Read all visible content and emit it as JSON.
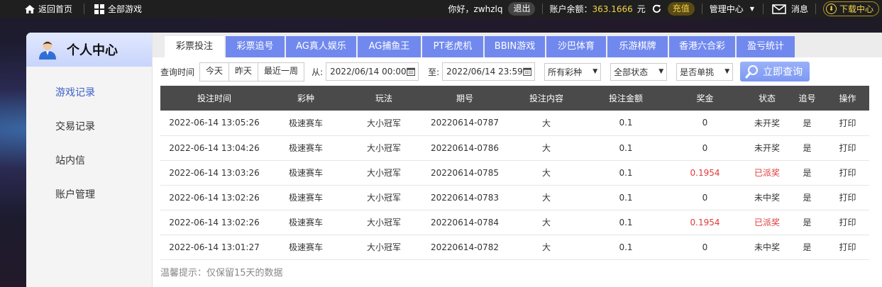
{
  "topbar": {
    "home": "返回首页",
    "all_games": "全部游戏",
    "greeting": "你好，zwhzlq",
    "logout": "退出",
    "balance_label": "账户余额：",
    "balance_value": "363.1666",
    "balance_unit": "元",
    "recharge": "充值",
    "manage": "管理中心",
    "messages": "消息",
    "download": "下载中心"
  },
  "sidebar": {
    "title": "个人中心",
    "items": [
      {
        "label": "游戏记录"
      },
      {
        "label": "交易记录"
      },
      {
        "label": "站内信"
      },
      {
        "label": "账户管理"
      }
    ]
  },
  "tabs": [
    "彩票投注",
    "彩票追号",
    "AG真人娱乐",
    "AG捕鱼王",
    "PT老虎机",
    "BBIN游戏",
    "沙巴体育",
    "乐游棋牌",
    "香港六合彩",
    "盈亏统计"
  ],
  "filter": {
    "time_label": "查询时间",
    "quick": [
      "今天",
      "昨天",
      "最近一周"
    ],
    "from_label": "从:",
    "from_value": "2022/06/14 00:00",
    "to_label": "至:",
    "to_value": "2022/06/14 23:59",
    "lottery_select": "所有彩种",
    "status_select": "全部状态",
    "single_select": "是否单挑",
    "search": "立即查询"
  },
  "table": {
    "headers": [
      "投注时间",
      "彩种",
      "玩法",
      "期号",
      "投注内容",
      "投注金额",
      "奖金",
      "状态",
      "追号",
      "操作"
    ],
    "rows": [
      [
        "2022-06-14 13:05:26",
        "极速赛车",
        "大小冠军",
        "20220614-0787",
        "大",
        "0.1",
        "0",
        "未开奖",
        "是",
        "打印"
      ],
      [
        "2022-06-14 13:04:26",
        "极速赛车",
        "大小冠军",
        "20220614-0786",
        "大",
        "0.1",
        "0",
        "未开奖",
        "是",
        "打印"
      ],
      [
        "2022-06-14 13:03:26",
        "极速赛车",
        "大小冠军",
        "20220614-0785",
        "大",
        "0.1",
        "0.1954",
        "已派奖",
        "是",
        "打印"
      ],
      [
        "2022-06-14 13:02:26",
        "极速赛车",
        "大小冠军",
        "20220614-0783",
        "大",
        "0.1",
        "0",
        "未中奖",
        "是",
        "打印"
      ],
      [
        "2022-06-14 13:02:26",
        "极速赛车",
        "大小冠军",
        "20220614-0784",
        "大",
        "0.1",
        "0.1954",
        "已派奖",
        "是",
        "打印"
      ],
      [
        "2022-06-14 13:01:27",
        "极速赛车",
        "大小冠军",
        "20220614-0782",
        "大",
        "0.1",
        "0",
        "未中奖",
        "是",
        "打印"
      ]
    ]
  },
  "tip": "温馨提示：仅保留15天的数据",
  "colors": {
    "accent": "#7189ee",
    "paid": "#e03a3a",
    "gold": "#f3d24c"
  }
}
